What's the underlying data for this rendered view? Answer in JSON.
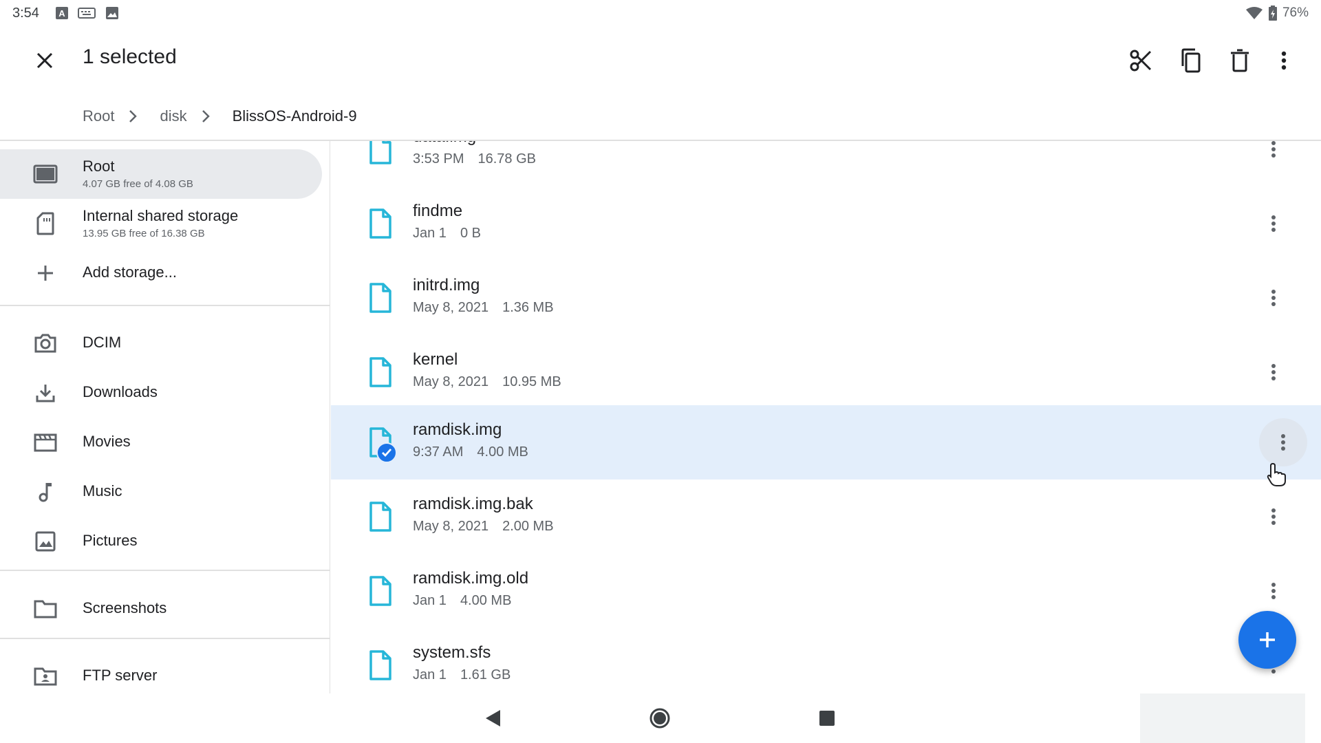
{
  "status_bar": {
    "time": "3:54",
    "battery": "76%",
    "icons": [
      "a-notification-icon",
      "ime-icon",
      "image-notification-icon",
      "wifi-icon",
      "battery-icon"
    ]
  },
  "action_bar": {
    "title": "1 selected",
    "actions": [
      "cut-icon",
      "copy-icon",
      "delete-icon",
      "overflow-menu-icon"
    ]
  },
  "breadcrumb": [
    "Root",
    "disk",
    "BlissOS-Android-9"
  ],
  "sidebar": {
    "storage": [
      {
        "label": "Root",
        "sub": "4.07 GB free of 4.08 GB",
        "icon": "drive-icon"
      },
      {
        "label": "Internal shared storage",
        "sub": "13.95 GB free of 16.38 GB",
        "icon": "sd-card-icon"
      },
      {
        "label": "Add storage...",
        "icon": "add-icon"
      }
    ],
    "folders": [
      {
        "label": "DCIM",
        "icon": "camera-icon"
      },
      {
        "label": "Downloads",
        "icon": "download-icon"
      },
      {
        "label": "Movies",
        "icon": "movie-icon"
      },
      {
        "label": "Music",
        "icon": "music-note-icon"
      },
      {
        "label": "Pictures",
        "icon": "image-icon"
      }
    ],
    "bookmarks": [
      {
        "label": "Screenshots",
        "icon": "folder-icon"
      }
    ],
    "other": [
      {
        "label": "FTP server",
        "icon": "ftp-server-icon"
      }
    ]
  },
  "files": [
    {
      "name": "data.img",
      "date": "3:53 PM",
      "size": "16.78 GB",
      "selected": false
    },
    {
      "name": "findme",
      "date": "Jan 1",
      "size": "0 B",
      "selected": false
    },
    {
      "name": "initrd.img",
      "date": "May 8, 2021",
      "size": "1.36 MB",
      "selected": false
    },
    {
      "name": "kernel",
      "date": "May 8, 2021",
      "size": "10.95 MB",
      "selected": false
    },
    {
      "name": "ramdisk.img",
      "date": "9:37 AM",
      "size": "4.00 MB",
      "selected": true
    },
    {
      "name": "ramdisk.img.bak",
      "date": "May 8, 2021",
      "size": "2.00 MB",
      "selected": false
    },
    {
      "name": "ramdisk.img.old",
      "date": "Jan 1",
      "size": "4.00 MB",
      "selected": false
    },
    {
      "name": "system.sfs",
      "date": "Jan 1",
      "size": "1.61 GB",
      "selected": false
    }
  ],
  "colors": {
    "accent": "#1a73e8",
    "file_icon": "#26b6d8",
    "selected_row": "#e3eefb",
    "active_sidebar": "#e8eaed"
  }
}
